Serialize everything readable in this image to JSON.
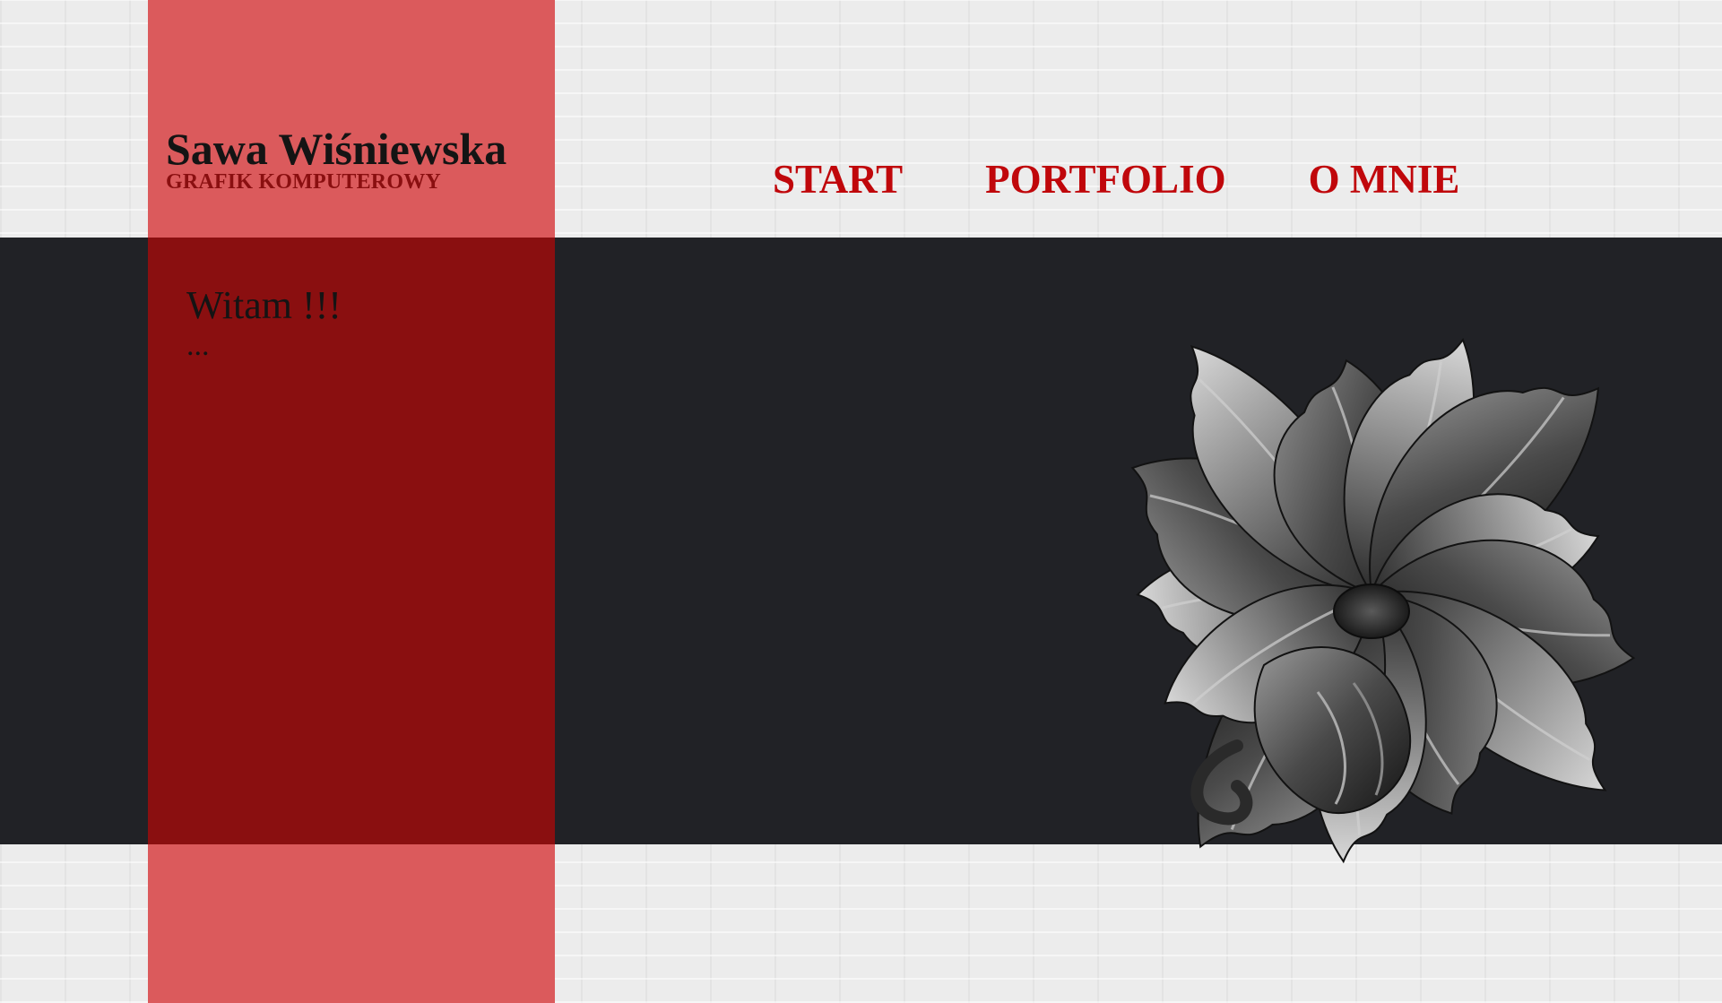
{
  "brand": {
    "name": "Sawa Wiśniewska",
    "tagline": "GRAFIK KOMPUTEROWY"
  },
  "nav": {
    "items": [
      {
        "label": "START"
      },
      {
        "label": "PORTFOLIO"
      },
      {
        "label": "O MNIE"
      }
    ]
  },
  "main": {
    "welcome_title": "Witam !!!",
    "welcome_body": "..."
  },
  "colors": {
    "page_background": "#ececec",
    "dark_band": "#212226",
    "side_column_light": "#db5a5c",
    "side_column_dark": "#8a0f10",
    "nav_link": "#c0070b",
    "title_text": "#141414"
  },
  "decoration": {
    "illustration": "grayscale-acanthus-flower-illustration"
  }
}
